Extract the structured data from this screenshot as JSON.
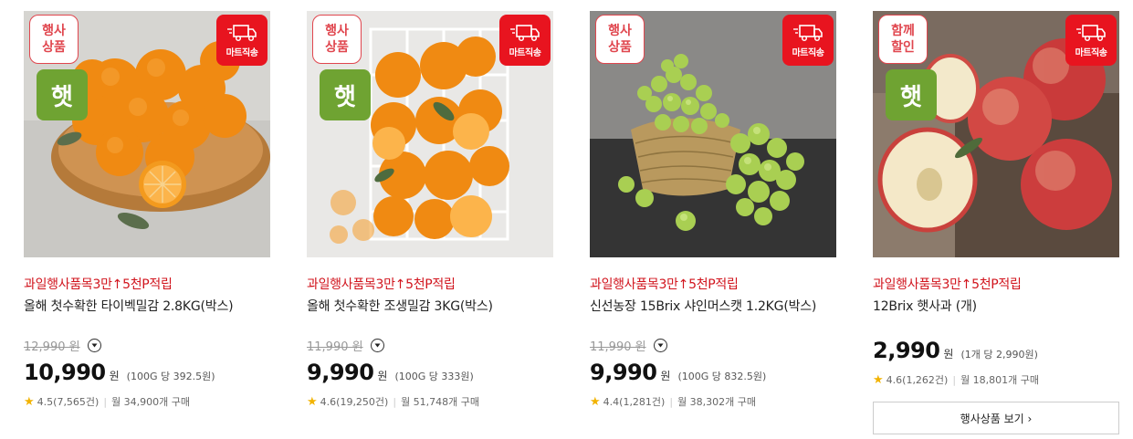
{
  "products": [
    {
      "event_badge": [
        "행사",
        "상품"
      ],
      "fresh_badge": "햇",
      "delivery_badge": "마트직송",
      "promo": "과일행사품목3만↑5천P적립",
      "name": "올해 첫수확한 타이벡밀감 2.8KG(박스)",
      "original_price": "12,990 원",
      "price": "10,990",
      "won": "원",
      "unit_price": "(100G 당 392.5원)",
      "rating": "4.5(7,565건)",
      "purchases": "월 34,900개 구매",
      "image": "tangerines-on-wooden-board"
    },
    {
      "event_badge": [
        "행사",
        "상품"
      ],
      "fresh_badge": "햇",
      "delivery_badge": "마트직송",
      "promo": "과일행사품목3만↑5천P적립",
      "name": "올해 첫수확한 조생밀감 3KG(박스)",
      "original_price": "11,990 원",
      "price": "9,990",
      "won": "원",
      "unit_price": "(100G 당 333원)",
      "rating": "4.6(19,250건)",
      "purchases": "월 51,748개 구매",
      "image": "tangerines-in-wire-basket"
    },
    {
      "event_badge": [
        "행사",
        "상품"
      ],
      "fresh_badge": "",
      "delivery_badge": "마트직송",
      "promo": "과일행사품목3만↑5천P적립",
      "name": "신선농장 15Brix 샤인머스캣 1.2KG(박스)",
      "original_price": "11,990 원",
      "price": "9,990",
      "won": "원",
      "unit_price": "(100G 당 832.5원)",
      "rating": "4.4(1,281건)",
      "purchases": "월 38,302개 구매",
      "image": "shine-muscat-grapes-in-basket"
    },
    {
      "event_badge": [
        "함께",
        "할인"
      ],
      "fresh_badge": "햇",
      "delivery_badge": "마트직송",
      "promo": "과일행사품목3만↑5천P적립",
      "name": "12Brix 햇사과 (개)",
      "original_price": "",
      "price": "2,990",
      "won": "원",
      "unit_price": "(1개 당 2,990원)",
      "rating": "4.6(1,262건)",
      "purchases": "월 18,801개 구매",
      "image": "red-apples-on-board",
      "more_button": "행사상품 보기 ›"
    }
  ],
  "colors": {
    "promo_red": "#d1141d",
    "fresh_green": "#6fa332",
    "delivery_red": "#e8141f",
    "star_yellow": "#f2b300"
  },
  "icons": [
    "truck-icon",
    "chevron-down-icon",
    "star-icon"
  ]
}
